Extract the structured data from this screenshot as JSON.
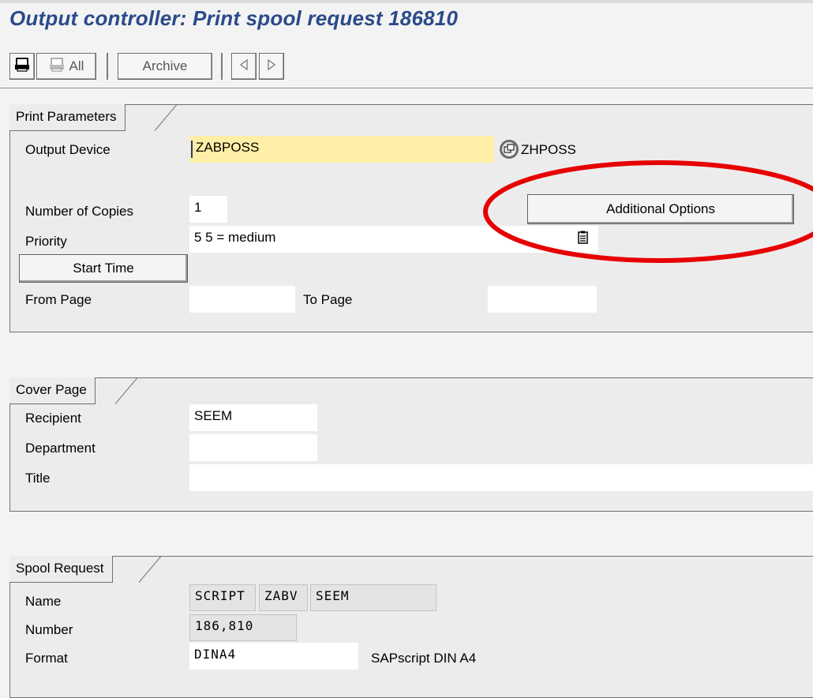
{
  "header": {
    "title": "Output controller: Print spool request 186810"
  },
  "toolbar": {
    "print_icon": "printer-icon",
    "print_all_label": "All",
    "archive_label": "Archive",
    "prev_icon": "previous-icon",
    "next_icon": "next-icon"
  },
  "print_parameters": {
    "tab": "Print Parameters",
    "output_device_label": "Output Device",
    "output_device_value": "ZABPOSS",
    "output_device_desc": "ZHPOSS",
    "copies_label": "Number of Copies",
    "copies_value": "1",
    "additional_options_label": "Additional Options",
    "priority_label": "Priority",
    "priority_value": "5 5 = medium",
    "start_time_label": "Start Time",
    "from_page_label": "From Page",
    "from_page_value": "",
    "to_page_label": "To Page",
    "to_page_value": ""
  },
  "cover_page": {
    "tab": "Cover Page",
    "recipient_label": "Recipient",
    "recipient_value": "SEEM",
    "department_label": "Department",
    "department_value": "",
    "title_label": "Title",
    "title_value": ""
  },
  "spool_request": {
    "tab": "Spool Request",
    "name_label": "Name",
    "name_value_1": "SCRIPT",
    "name_value_2": "ZABV",
    "name_value_3": "SEEM",
    "number_label": "Number",
    "number_value": "186,810",
    "format_label": "Format",
    "format_value": "DINA4",
    "format_desc": "SAPscript DIN A4"
  },
  "colors": {
    "title": "#2a4a8a",
    "required_field": "#ffeea6",
    "annotation": "#e60000"
  }
}
